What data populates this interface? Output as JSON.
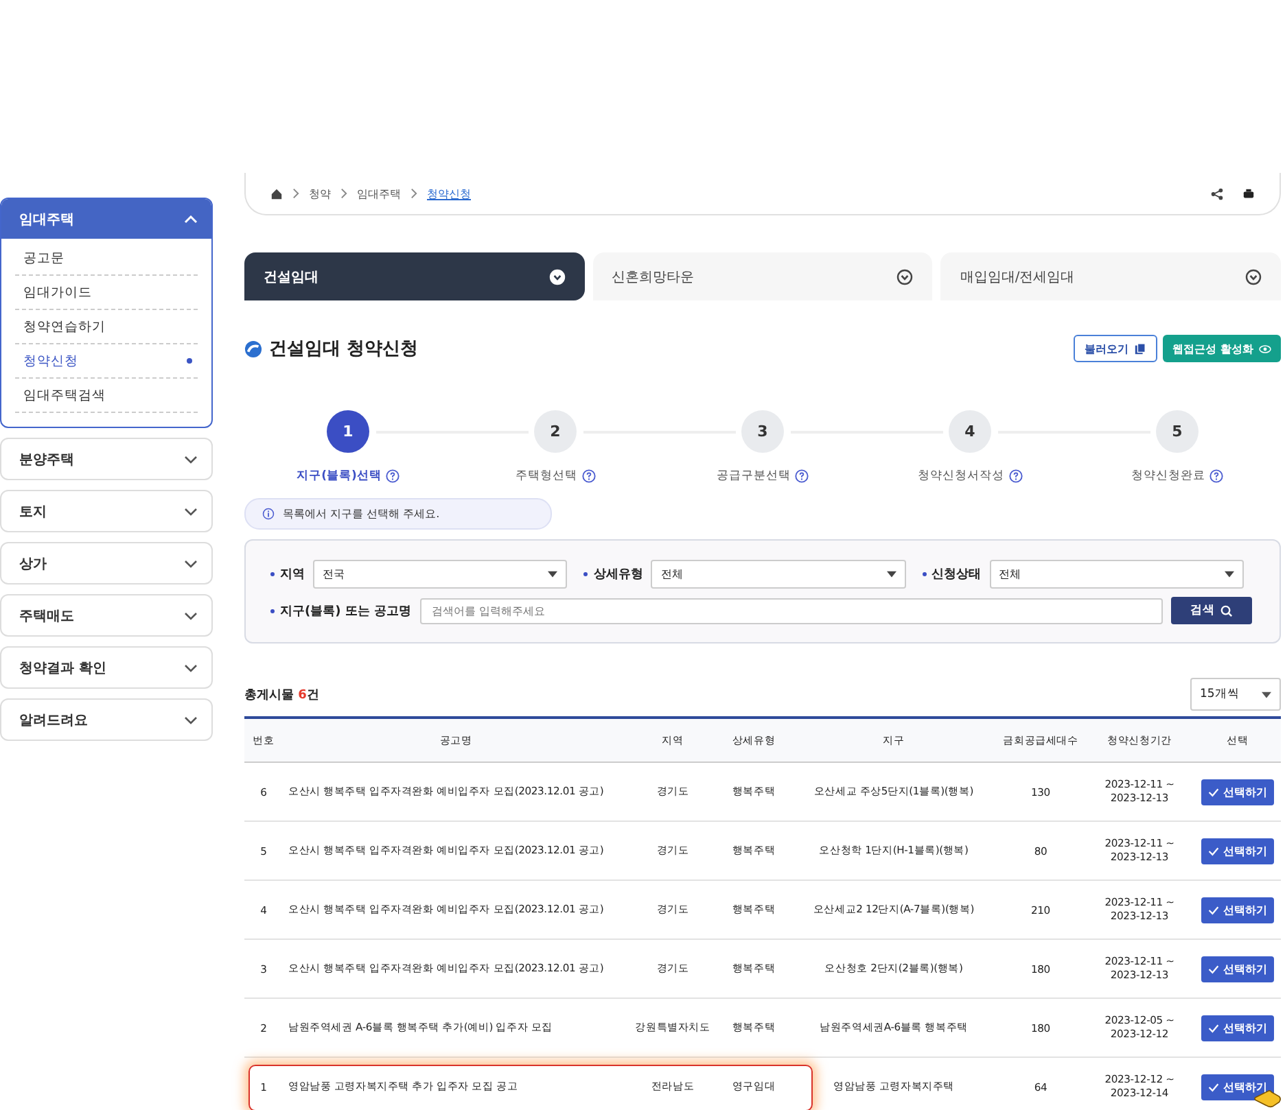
{
  "sidebar": {
    "groups": [
      {
        "label": "임대주택",
        "expanded": true,
        "items": [
          {
            "label": "공고문",
            "selected": false
          },
          {
            "label": "임대가이드",
            "selected": false
          },
          {
            "label": "청약연습하기",
            "selected": false
          },
          {
            "label": "청약신청",
            "selected": true
          },
          {
            "label": "임대주택검색",
            "selected": false
          }
        ]
      },
      {
        "label": "분양주택",
        "expanded": false
      },
      {
        "label": "토지",
        "expanded": false
      },
      {
        "label": "상가",
        "expanded": false
      },
      {
        "label": "주택매도",
        "expanded": false
      },
      {
        "label": "청약결과 확인",
        "expanded": false
      },
      {
        "label": "알려드려요",
        "expanded": false
      }
    ]
  },
  "breadcrumb": [
    "청약",
    "임대주택",
    "청약신청"
  ],
  "tabs": [
    {
      "label": "건설임대",
      "selected": true
    },
    {
      "label": "신혼희망타운",
      "selected": false
    },
    {
      "label": "매입임대/전세임대",
      "selected": false
    }
  ],
  "title": "건설임대 청약신청",
  "actions": {
    "load": "불러오기",
    "accessibility": "웹접근성 활성화"
  },
  "steps": [
    {
      "number": "1",
      "label": "지구(블록)선택",
      "selected": true
    },
    {
      "number": "2",
      "label": "주택형선택",
      "selected": false
    },
    {
      "number": "3",
      "label": "공급구분선택",
      "selected": false
    },
    {
      "number": "4",
      "label": "청약신청서작성",
      "selected": false
    },
    {
      "number": "5",
      "label": "청약신청완료",
      "selected": false
    }
  ],
  "notice": "목록에서 지구를 선택해 주세요.",
  "filters": {
    "selects": [
      {
        "label": "지역",
        "value": "전국"
      },
      {
        "label": "상세유형",
        "value": "전체"
      },
      {
        "label": "신청상태",
        "value": "전체"
      }
    ],
    "search_label": "지구(블록) 또는 공고명",
    "search_placeholder": "검색어를 입력해주세요",
    "search_button": "검색"
  },
  "count": {
    "prefix": "총게시물 ",
    "number": "6",
    "suffix": "건"
  },
  "page_size": "15개씩",
  "table": {
    "columns": [
      "번호",
      "공고명",
      "지역",
      "상세유형",
      "지구",
      "금회공급세대수",
      "청약신청기간",
      "선택"
    ],
    "rows": [
      {
        "cells": [
          "6",
          "오산시 행복주택 입주자격완화 예비입주자 모집(2023.12.01 공고)",
          "경기도",
          "행복주택",
          "오산세교 주상5단지(1블록)(행복)",
          "130",
          "2023-12-11 ~\n2023-12-13"
        ],
        "button": "선택하기",
        "highlighted": false
      },
      {
        "cells": [
          "5",
          "오산시 행복주택 입주자격완화 예비입주자 모집(2023.12.01 공고)",
          "경기도",
          "행복주택",
          "오산청학 1단지(H-1블록)(행복)",
          "80",
          "2023-12-11 ~\n2023-12-13"
        ],
        "button": "선택하기",
        "highlighted": false
      },
      {
        "cells": [
          "4",
          "오산시 행복주택 입주자격완화 예비입주자 모집(2023.12.01 공고)",
          "경기도",
          "행복주택",
          "오산세교2 12단지(A-7블록)(행복)",
          "210",
          "2023-12-11 ~\n2023-12-13"
        ],
        "button": "선택하기",
        "highlighted": false
      },
      {
        "cells": [
          "3",
          "오산시 행복주택 입주자격완화 예비입주자 모집(2023.12.01 공고)",
          "경기도",
          "행복주택",
          "오산청호 2단지(2블록)(행복)",
          "180",
          "2023-12-11 ~\n2023-12-13"
        ],
        "button": "선택하기",
        "highlighted": false
      },
      {
        "cells": [
          "2",
          "남원주역세권 A-6블록 행복주택 추가(예비) 입주자 모집",
          "강원특별자치도",
          "행복주택",
          "남원주역세권A-6블록 행복주택",
          "180",
          "2023-12-05 ~\n2023-12-12"
        ],
        "button": "선택하기",
        "highlighted": false
      },
      {
        "cells": [
          "1",
          "영암남풍 고령자복지주택 추가 입주자 모집 공고",
          "전라남도",
          "영구임대",
          "영암남풍 고령자복지주택",
          "64",
          "2023-12-12 ~\n2023-12-14"
        ],
        "button": "선택하기",
        "highlighted": true
      }
    ]
  }
}
